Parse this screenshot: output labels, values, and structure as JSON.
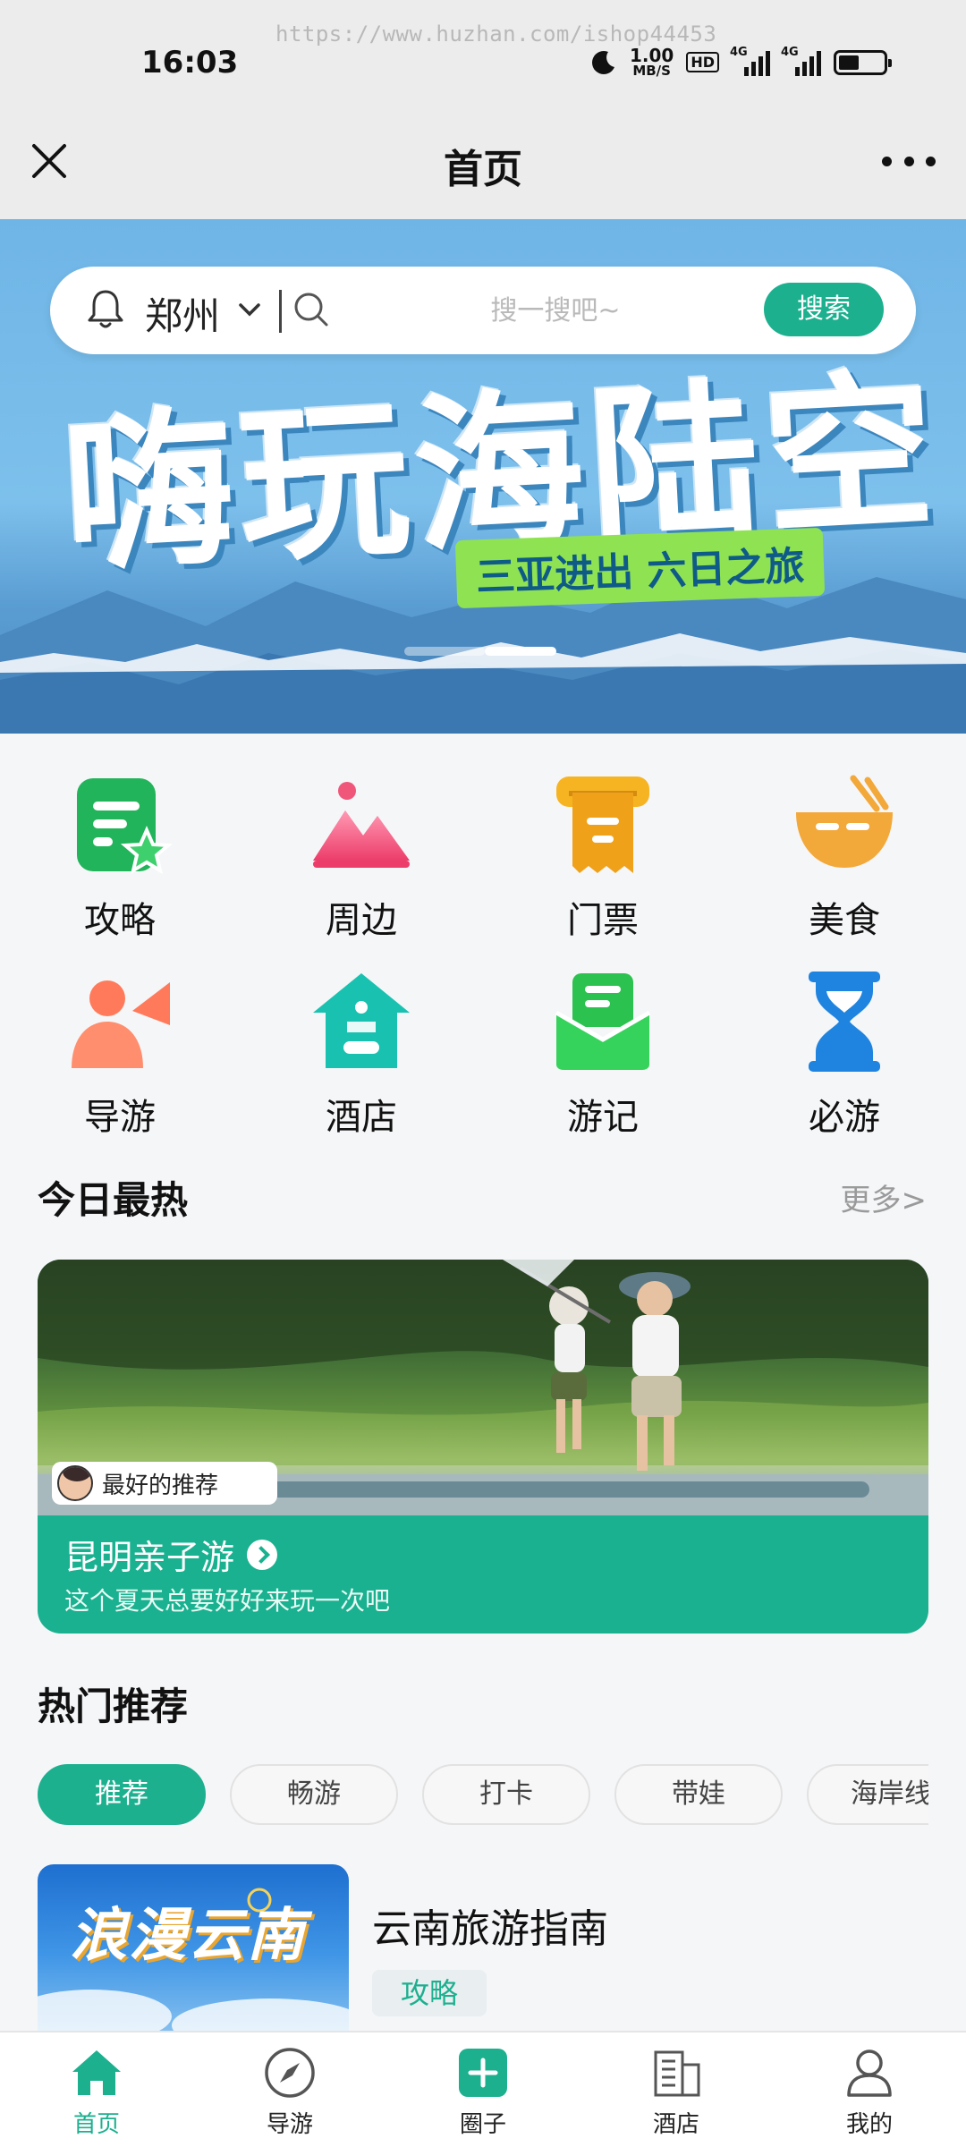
{
  "status_bar": {
    "watermark": "https://www.huzhan.com/ishop44453",
    "time": "16:03",
    "net_speed_value": "1.00",
    "net_speed_unit": "MB/S",
    "hd_badge": "HD",
    "signal_1_label": "4G",
    "signal_2_label": "4G",
    "battery_level": 0.45,
    "icons": [
      "moon-icon",
      "signal-icon",
      "battery-icon"
    ]
  },
  "nav": {
    "title": "首页",
    "icons": [
      "close-icon",
      "more-icon"
    ]
  },
  "banner": {
    "title": "嗨玩海陆空",
    "subtitle": "三亚进出 六日之旅",
    "page_count": 2,
    "active_page": 2
  },
  "search": {
    "city": "郑州",
    "placeholder": "搜一搜吧~",
    "button_label": "搜索"
  },
  "categories": [
    {
      "label": "攻略",
      "icon": "guide-icon",
      "color": "#22b45a"
    },
    {
      "label": "周边",
      "icon": "mountain-icon",
      "color": "#f0557a"
    },
    {
      "label": "门票",
      "icon": "ticket-icon",
      "color": "#f0a11a"
    },
    {
      "label": "美食",
      "icon": "bowl-icon",
      "color": "#f3a83a"
    },
    {
      "label": "导游",
      "icon": "tour-guide-icon",
      "color": "#ff7a5a"
    },
    {
      "label": "酒店",
      "icon": "hotel-icon",
      "color": "#19c2b0"
    },
    {
      "label": "游记",
      "icon": "travel-note-icon",
      "color": "#2bc24f"
    },
    {
      "label": "必游",
      "icon": "hourglass-icon",
      "color": "#1f84e0"
    }
  ],
  "hot_today": {
    "heading": "今日最热",
    "more": "更多>",
    "tag": "最好的推荐",
    "title": "昆明亲子游",
    "subtitle": "这个夏天总要好好来玩一次吧"
  },
  "hot_recommend": {
    "heading": "热门推荐",
    "chips": [
      "推荐",
      "畅游",
      "打卡",
      "带娃",
      "海岸线"
    ],
    "active_chip": 0,
    "item": {
      "title": "云南旅游指南",
      "tag": "攻略",
      "thumb_text": "浪漫云南"
    }
  },
  "tab_bar": [
    {
      "label": "首页",
      "icon": "home-icon",
      "active": true
    },
    {
      "label": "导游",
      "icon": "compass-icon",
      "active": false
    },
    {
      "label": "圈子",
      "icon": "plus-icon",
      "active": false
    },
    {
      "label": "酒店",
      "icon": "building-icon",
      "active": false
    },
    {
      "label": "我的",
      "icon": "user-icon",
      "active": false
    }
  ],
  "colors": {
    "accent": "#1cb08f",
    "tab_active": "#1cb08f"
  }
}
